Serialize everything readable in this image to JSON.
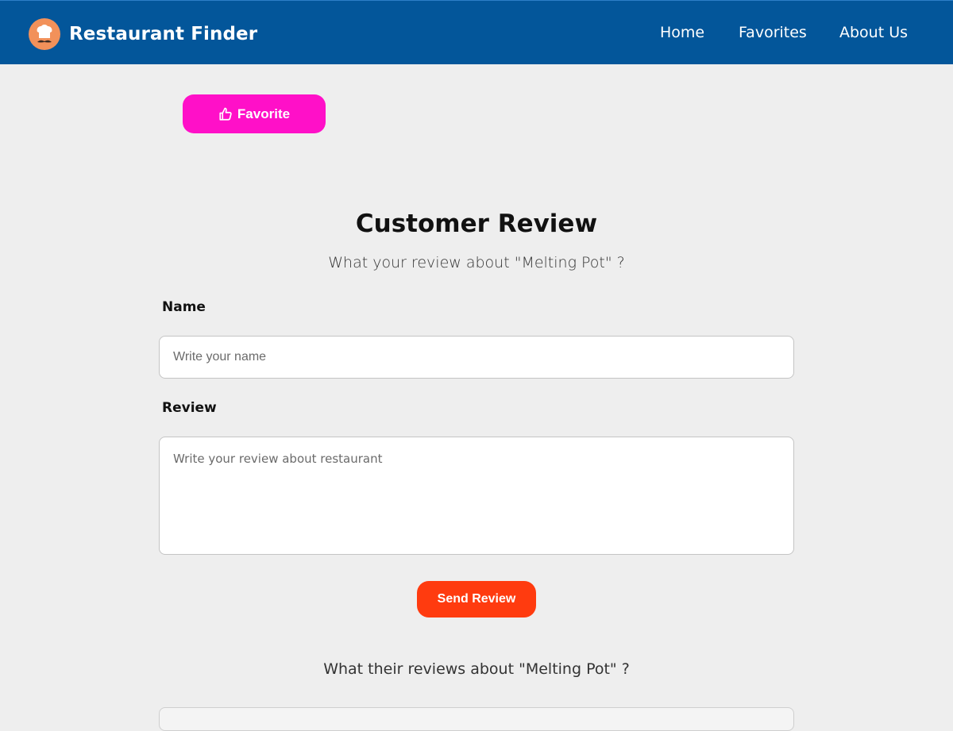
{
  "header": {
    "brand": "Restaurant Finder",
    "logo_icon": "chef-mustache-icon",
    "nav": [
      {
        "label": "Home"
      },
      {
        "label": "Favorites"
      },
      {
        "label": "About Us"
      }
    ]
  },
  "favorite_button": {
    "label": "Favorite",
    "icon": "thumbs-up-icon",
    "color": "#ff10c8"
  },
  "review_form": {
    "title": "Customer Review",
    "subtitle": "What your review about \"Melting Pot\" ?",
    "name_label": "Name",
    "name_placeholder": "Write your name",
    "review_label": "Review",
    "review_placeholder": "Write your review about restaurant",
    "submit_label": "Send Review",
    "submit_color": "#ff3b0f"
  },
  "reviews_section": {
    "title": "What their reviews about \"Melting Pot\" ?"
  },
  "colors": {
    "navbar": "#03569a",
    "background": "#eeeeee"
  }
}
